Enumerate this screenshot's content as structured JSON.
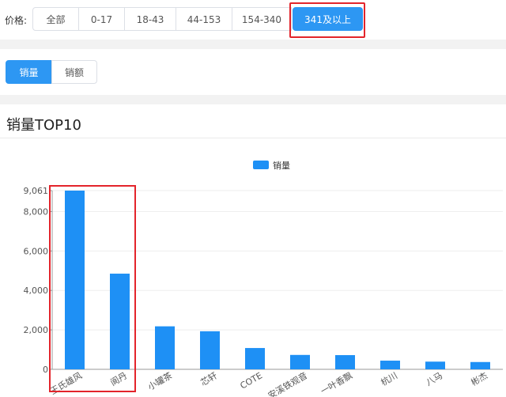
{
  "price_filter": {
    "label": "价格:",
    "options": [
      "全部",
      "0-17",
      "18-43",
      "44-153",
      "154-340",
      "341及以上"
    ],
    "selected": "341及以上"
  },
  "metric_tabs": {
    "options": [
      "销量",
      "销额"
    ],
    "selected": "销量"
  },
  "panel": {
    "title": "销量TOP10"
  },
  "colors": {
    "accent": "#2d97f3",
    "bar": "#1e90f5",
    "highlight": "#e3242b"
  },
  "chart_data": {
    "type": "bar",
    "categories": [
      "王氏雄风",
      "阆丹",
      "小罐茶",
      "芯轩",
      "COTE",
      "安溪铁观音",
      "一叶香飘",
      "杭川",
      "八马",
      "彬杰"
    ],
    "series": [
      {
        "name": "销量",
        "values": [
          9061,
          4850,
          2180,
          1930,
          1080,
          730,
          720,
          440,
          390,
          370
        ]
      }
    ],
    "y_ticks": [
      "0",
      "2,000",
      "4,000",
      "6,000",
      "8,000",
      "9,061"
    ],
    "ylim": [
      0,
      9061
    ],
    "legend": "top-center",
    "grid": true
  }
}
